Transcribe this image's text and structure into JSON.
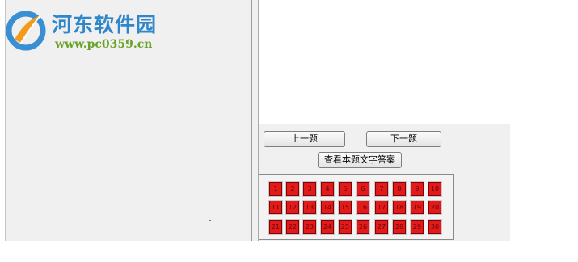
{
  "watermark": {
    "title": "河东软件园",
    "url": "www.pc0359.cn"
  },
  "controls": {
    "prev_label": "上一题",
    "next_label": "下一题",
    "answer_label": "查看本题文字答案"
  },
  "questions": [
    "1",
    "2",
    "3",
    "4",
    "5",
    "6",
    "7",
    "8",
    "9",
    "10",
    "11",
    "12",
    "13",
    "14",
    "15",
    "16",
    "17",
    "18",
    "19",
    "20",
    "21",
    "22",
    "23",
    "24",
    "25",
    "26",
    "27",
    "28",
    "29",
    "30"
  ],
  "colors": {
    "cell": "#e11b1b",
    "cell_border": "#8a0000",
    "panel": "#f0f0f0",
    "watermark_blue": "#2f86c9",
    "watermark_green": "#6aa329"
  }
}
